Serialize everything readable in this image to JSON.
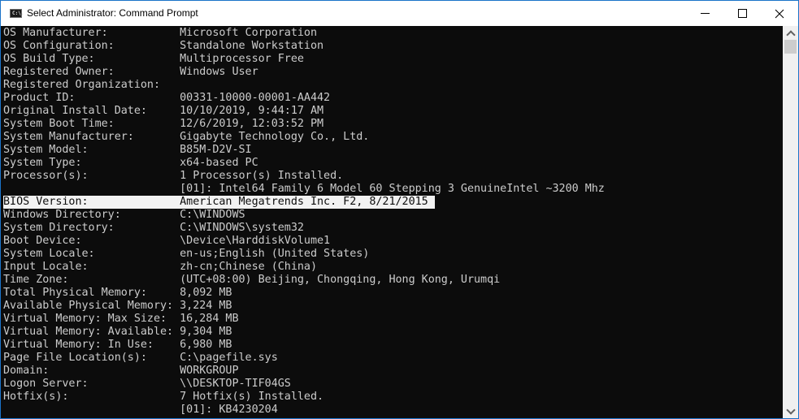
{
  "window": {
    "title": "Select Administrator: Command Prompt",
    "icon": "cmd-icon",
    "icon_text": "C:\\."
  },
  "console": {
    "selected_line_index": 13,
    "lines": [
      "OS Manufacturer:           Microsoft Corporation",
      "OS Configuration:          Standalone Workstation",
      "OS Build Type:             Multiprocessor Free",
      "Registered Owner:          Windows User",
      "Registered Organization:",
      "Product ID:                00331-10000-00001-AA442",
      "Original Install Date:     10/10/2019, 9:44:17 AM",
      "System Boot Time:          12/6/2019, 12:03:52 PM",
      "System Manufacturer:       Gigabyte Technology Co., Ltd.",
      "System Model:              B85M-D2V-SI",
      "System Type:               x64-based PC",
      "Processor(s):              1 Processor(s) Installed.",
      "                           [01]: Intel64 Family 6 Model 60 Stepping 3 GenuineIntel ~3200 Mhz",
      "BIOS Version:              American Megatrends Inc. F2, 8/21/2015 ",
      "Windows Directory:         C:\\WINDOWS",
      "System Directory:          C:\\WINDOWS\\system32",
      "Boot Device:               \\Device\\HarddiskVolume1",
      "System Locale:             en-us;English (United States)",
      "Input Locale:              zh-cn;Chinese (China)",
      "Time Zone:                 (UTC+08:00) Beijing, Chongqing, Hong Kong, Urumqi",
      "Total Physical Memory:     8,092 MB",
      "Available Physical Memory: 3,224 MB",
      "Virtual Memory: Max Size:  16,284 MB",
      "Virtual Memory: Available: 9,304 MB",
      "Virtual Memory: In Use:    6,980 MB",
      "Page File Location(s):     C:\\pagefile.sys",
      "Domain:                    WORKGROUP",
      "Logon Server:              \\\\DESKTOP-TIF04GS",
      "Hotfix(s):                 7 Hotfix(s) Installed.",
      "                           [01]: KB4230204"
    ]
  },
  "colors": {
    "background": "#0c0c0c",
    "text": "#cccccc",
    "selection": "#f2f2f2",
    "border": "#1a73c9"
  }
}
